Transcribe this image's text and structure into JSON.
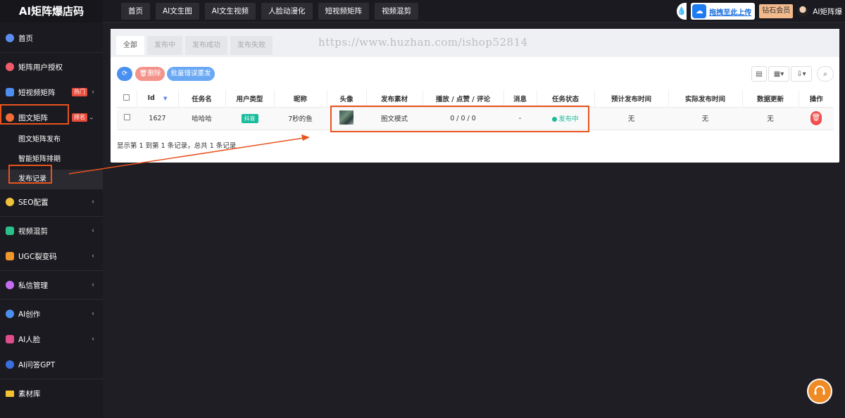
{
  "app": {
    "title": "AI矩阵爆店码"
  },
  "topnav": [
    "首页",
    "AI文生图",
    "AI文生视频",
    "人脸动漫化",
    "短视频矩阵",
    "视频混剪"
  ],
  "topright": {
    "upload_text": "拖拽至此上传",
    "member": "钻石会员",
    "user": "AI矩阵爆"
  },
  "sidebar": {
    "items": [
      {
        "label": "首页"
      },
      {
        "label": "矩阵用户授权"
      },
      {
        "label": "短视频矩阵",
        "badge": "热门"
      },
      {
        "label": "图文矩阵",
        "badge": "排名"
      },
      {
        "label": "SEO配置"
      },
      {
        "label": "视频混剪"
      },
      {
        "label": "UGC裂变码"
      },
      {
        "label": "私信管理"
      },
      {
        "label": "AI创作"
      },
      {
        "label": "AI人脸"
      },
      {
        "label": "AI问答GPT"
      },
      {
        "label": "素材库"
      }
    ],
    "sub": [
      "图文矩阵发布",
      "智能矩阵排期",
      "发布记录"
    ]
  },
  "tabs": [
    "全部",
    "发布中",
    "发布成功",
    "发布失败"
  ],
  "watermark": "https://www.huzhan.com/ishop52814",
  "toolbar": {
    "delete": "删除",
    "batch": "批量错误重发"
  },
  "table": {
    "headers": [
      "Id",
      "任务名",
      "用户类型",
      "昵称",
      "头像",
      "发布素材",
      "播放 / 点赞 / 评论",
      "消息",
      "任务状态",
      "预计发布时间",
      "实际发布时间",
      "数据更新",
      "操作"
    ],
    "row": {
      "id": "1627",
      "name": "哈哈哈",
      "type": "抖音",
      "nickname": "7秒的鱼",
      "material": "图文模式",
      "stats": "0 / 0 / 0",
      "message": "-",
      "status": "发布中",
      "planned": "无",
      "actual": "无",
      "updated": "无"
    }
  },
  "summary": "显示第 1 到第 1 条记录，总共 1 条记录",
  "colors": {
    "accent": "#18bc9c",
    "danger": "#f05050",
    "highlight": "#e9531e",
    "primary": "#4a90f0"
  }
}
